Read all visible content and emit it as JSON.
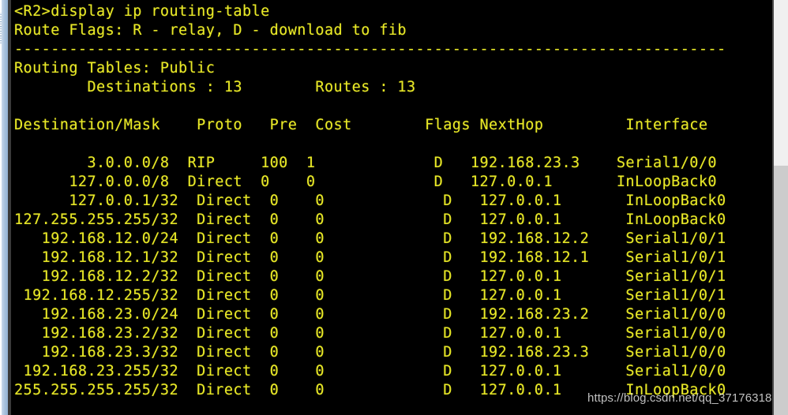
{
  "terminal": {
    "foreground_color": "#e8e827",
    "background_color": "#000000",
    "prompt_line": "<R2>display ip routing-table",
    "flags_legend": "Route Flags: R - relay, D - download to fib",
    "separator": "------------------------------------------------------------------------------",
    "table_scope_label": "Routing Tables: Public",
    "summary_line": "        Destinations : 13        Routes : 13",
    "summary": {
      "destinations_label": "Destinations",
      "destinations_value": "13",
      "routes_label": "Routes",
      "routes_value": "13"
    },
    "columns": [
      "Destination/Mask",
      "Proto",
      "Pre",
      "Cost",
      "Flags",
      "NextHop",
      "Interface"
    ],
    "header_line": "Destination/Mask    Proto   Pre  Cost        Flags NextHop         Interface",
    "rows": [
      {
        "line": "        3.0.0.0/8  RIP     100  1             D   192.168.23.3    Serial1/0/0",
        "destination": "3.0.0.0/8",
        "proto": "RIP",
        "pre": "100",
        "cost": "1",
        "flags": "D",
        "nexthop": "192.168.23.3",
        "interface": "Serial1/0/0"
      },
      {
        "line": "      127.0.0.0/8  Direct  0    0             D   127.0.0.1       InLoopBack0",
        "destination": "127.0.0.0/8",
        "proto": "Direct",
        "pre": "0",
        "cost": "0",
        "flags": "D",
        "nexthop": "127.0.0.1",
        "interface": "InLoopBack0"
      },
      {
        "line": "      127.0.0.1/32  Direct  0    0             D   127.0.0.1       InLoopBack0",
        "destination": "127.0.0.1/32",
        "proto": "Direct",
        "pre": "0",
        "cost": "0",
        "flags": "D",
        "nexthop": "127.0.0.1",
        "interface": "InLoopBack0"
      },
      {
        "line": "127.255.255.255/32  Direct  0    0             D   127.0.0.1       InLoopBack0",
        "destination": "127.255.255.255/32",
        "proto": "Direct",
        "pre": "0",
        "cost": "0",
        "flags": "D",
        "nexthop": "127.0.0.1",
        "interface": "InLoopBack0"
      },
      {
        "line": "   192.168.12.0/24  Direct  0    0             D   192.168.12.2    Serial1/0/1",
        "destination": "192.168.12.0/24",
        "proto": "Direct",
        "pre": "0",
        "cost": "0",
        "flags": "D",
        "nexthop": "192.168.12.2",
        "interface": "Serial1/0/1"
      },
      {
        "line": "   192.168.12.1/32  Direct  0    0             D   192.168.12.1    Serial1/0/1",
        "destination": "192.168.12.1/32",
        "proto": "Direct",
        "pre": "0",
        "cost": "0",
        "flags": "D",
        "nexthop": "192.168.12.1",
        "interface": "Serial1/0/1"
      },
      {
        "line": "   192.168.12.2/32  Direct  0    0             D   127.0.0.1       Serial1/0/1",
        "destination": "192.168.12.2/32",
        "proto": "Direct",
        "pre": "0",
        "cost": "0",
        "flags": "D",
        "nexthop": "127.0.0.1",
        "interface": "Serial1/0/1"
      },
      {
        "line": " 192.168.12.255/32  Direct  0    0             D   127.0.0.1       Serial1/0/1",
        "destination": "192.168.12.255/32",
        "proto": "Direct",
        "pre": "0",
        "cost": "0",
        "flags": "D",
        "nexthop": "127.0.0.1",
        "interface": "Serial1/0/1"
      },
      {
        "line": "   192.168.23.0/24  Direct  0    0             D   192.168.23.2    Serial1/0/0",
        "destination": "192.168.23.0/24",
        "proto": "Direct",
        "pre": "0",
        "cost": "0",
        "flags": "D",
        "nexthop": "192.168.23.2",
        "interface": "Serial1/0/0"
      },
      {
        "line": "   192.168.23.2/32  Direct  0    0             D   127.0.0.1       Serial1/0/0",
        "destination": "192.168.23.2/32",
        "proto": "Direct",
        "pre": "0",
        "cost": "0",
        "flags": "D",
        "nexthop": "127.0.0.1",
        "interface": "Serial1/0/0"
      },
      {
        "line": "   192.168.23.3/32  Direct  0    0             D   192.168.23.3    Serial1/0/0",
        "destination": "192.168.23.3/32",
        "proto": "Direct",
        "pre": "0",
        "cost": "0",
        "flags": "D",
        "nexthop": "192.168.23.3",
        "interface": "Serial1/0/0"
      },
      {
        "line": " 192.168.23.255/32  Direct  0    0             D   127.0.0.1       Serial1/0/0",
        "destination": "192.168.23.255/32",
        "proto": "Direct",
        "pre": "0",
        "cost": "0",
        "flags": "D",
        "nexthop": "127.0.0.1",
        "interface": "Serial1/0/0"
      },
      {
        "line": "255.255.255.255/32  Direct  0    0             D   127.0.0.1       InLoopBack0",
        "destination": "255.255.255.255/32",
        "proto": "Direct",
        "pre": "0",
        "cost": "0",
        "flags": "D",
        "nexthop": "127.0.0.1",
        "interface": "InLoopBack0"
      }
    ]
  },
  "watermark": {
    "text": "https://blog.csdn.net/qq_37176318"
  }
}
